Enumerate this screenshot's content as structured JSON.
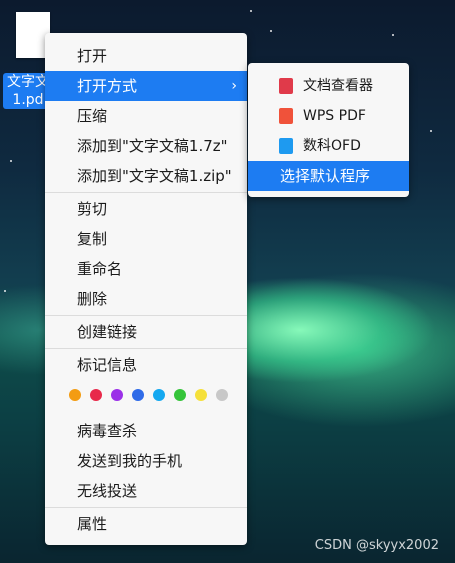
{
  "desktop": {
    "file_label_line1": "文字文",
    "file_label_line2": "1.pd"
  },
  "context_menu": {
    "groups": [
      [
        "打开",
        "打开方式",
        "压缩",
        "添加到\"文字文稿1.7z\"",
        "添加到\"文字文稿1.zip\""
      ],
      [
        "剪切",
        "复制",
        "重命名",
        "删除"
      ],
      [
        "创建链接"
      ],
      [
        "标记信息"
      ],
      [
        "病毒查杀",
        "发送到我的手机",
        "无线投送"
      ],
      [
        "属性"
      ]
    ],
    "submenu_arrow": "›",
    "tag_colors": [
      "#f39c12",
      "#e8294a",
      "#9b30e8",
      "#2f6be8",
      "#14a8f0",
      "#35c43a",
      "#f5e03a",
      "#c8c8c8"
    ]
  },
  "submenu": {
    "items": [
      {
        "label": "文档查看器",
        "icon": "document-viewer-icon",
        "color": "#e03a4a"
      },
      {
        "label": "WPS PDF",
        "icon": "wps-pdf-icon",
        "color": "#f0523a"
      },
      {
        "label": "数科OFD",
        "icon": "ofd-icon",
        "color": "#1e9af0"
      }
    ],
    "choose_default": "选择默认程序"
  },
  "watermark": "CSDN @skyyx2002"
}
